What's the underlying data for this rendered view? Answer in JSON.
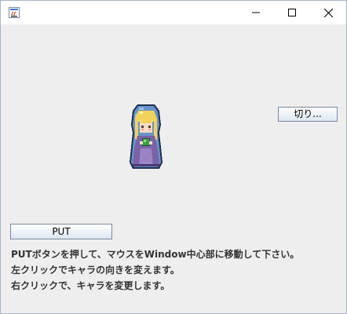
{
  "window": {
    "controls": {
      "minimize_icon": "minimize-icon",
      "maximize_icon": "maximize-icon",
      "close_icon": "close-icon"
    }
  },
  "buttons": {
    "toggle_label": "切り...",
    "put_label": "PUT"
  },
  "instructions": [
    "PUTボタンを押して、マウスをWindow中心部に移動して下さい。",
    "左クリックでキャラの向きを変えます。",
    "右クリックで、キャラを変更します。"
  ],
  "colors": {
    "window_bg": "#eeeeee",
    "text": "#333333",
    "character_hood": "#6a93c8",
    "character_robe": "#7a62a8",
    "character_hair": "#f2d25a"
  }
}
